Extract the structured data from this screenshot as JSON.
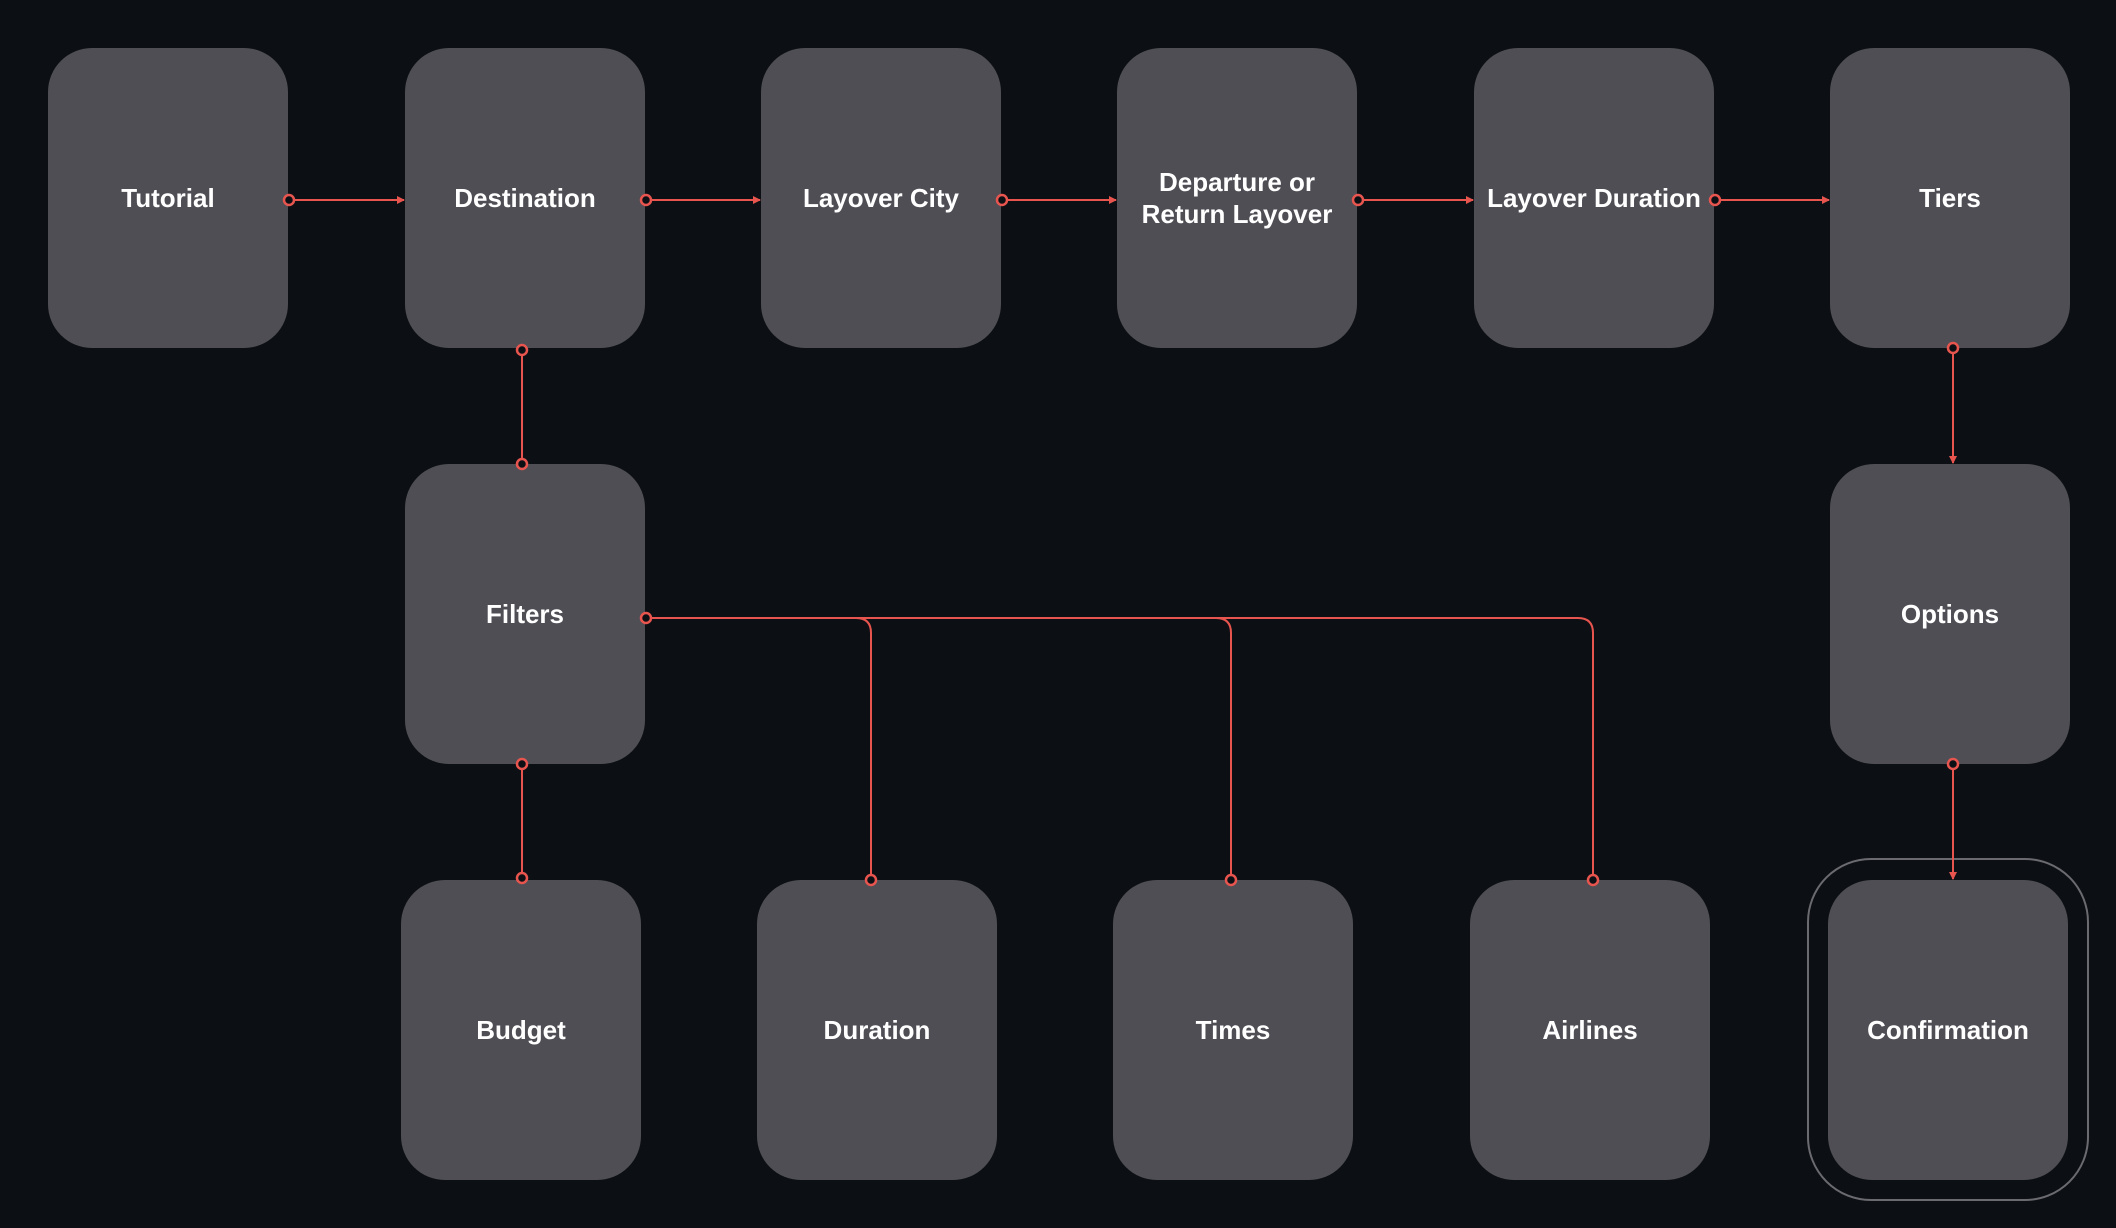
{
  "colors": {
    "background": "#0c1015",
    "node": "#4f4e55",
    "connector": "#e8554f",
    "text": "#ffffff",
    "highlight_ring": "#6a6a70"
  },
  "nodes": {
    "tutorial": "Tutorial",
    "destination": "Destination",
    "layover_city": "Layover City",
    "departure_return": "Departure or Return Layover",
    "layover_duration": "Layover Duration",
    "tiers": "Tiers",
    "filters": "Filters",
    "options": "Options",
    "budget": "Budget",
    "duration": "Duration",
    "times": "Times",
    "airlines": "Airlines",
    "confirmation": "Confirmation"
  },
  "edges": [
    [
      "Tutorial",
      "Destination"
    ],
    [
      "Destination",
      "Layover City"
    ],
    [
      "Layover City",
      "Departure or Return Layover"
    ],
    [
      "Departure or Return Layover",
      "Layover Duration"
    ],
    [
      "Layover Duration",
      "Tiers"
    ],
    [
      "Destination",
      "Filters"
    ],
    [
      "Tiers",
      "Options"
    ],
    [
      "Options",
      "Confirmation"
    ],
    [
      "Filters",
      "Budget"
    ],
    [
      "Filters",
      "Duration"
    ],
    [
      "Filters",
      "Times"
    ],
    [
      "Filters",
      "Airlines"
    ]
  ],
  "selected_node": "Confirmation"
}
